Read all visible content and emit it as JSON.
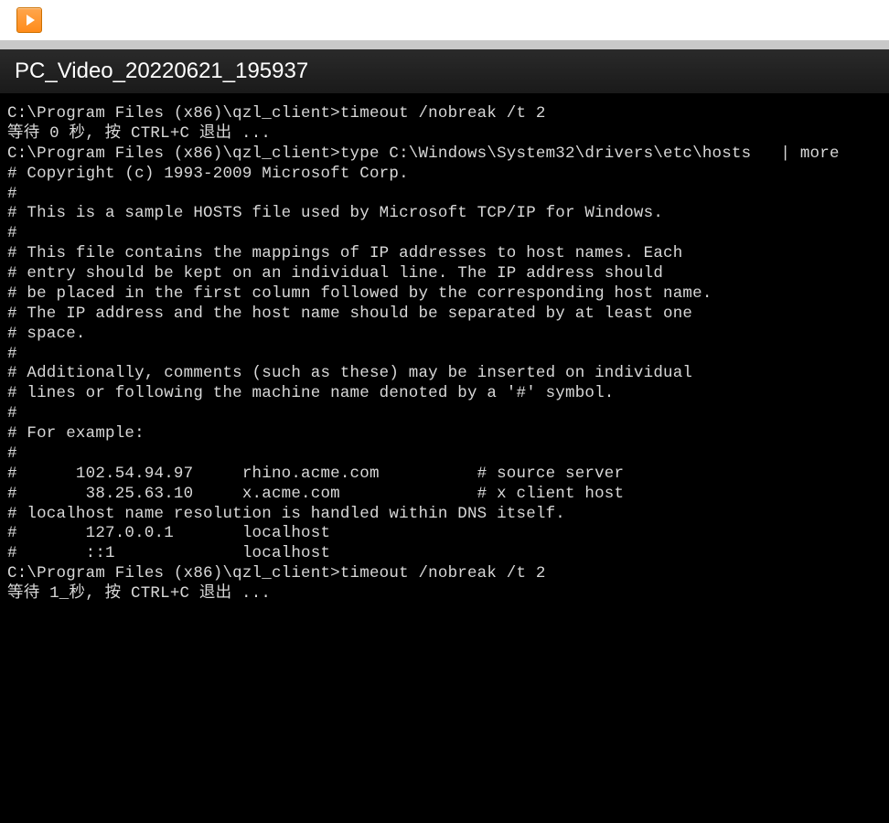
{
  "toolbar": {
    "play_icon_name": "play-icon"
  },
  "title": "PC_Video_20220621_195937",
  "terminal": {
    "lines": [
      "C:\\Program Files (x86)\\qzl_client>timeout /nobreak /t 2",
      "",
      "等待 0 秒, 按 CTRL+C 退出 ...",
      "",
      "C:\\Program Files (x86)\\qzl_client>type C:\\Windows\\System32\\drivers\\etc\\hosts   | more",
      "# Copyright (c) 1993-2009 Microsoft Corp.",
      "#",
      "# This is a sample HOSTS file used by Microsoft TCP/IP for Windows.",
      "#",
      "# This file contains the mappings of IP addresses to host names. Each",
      "# entry should be kept on an individual line. The IP address should",
      "# be placed in the first column followed by the corresponding host name.",
      "# The IP address and the host name should be separated by at least one",
      "# space.",
      "#",
      "# Additionally, comments (such as these) may be inserted on individual",
      "# lines or following the machine name denoted by a '#' symbol.",
      "#",
      "# For example:",
      "#",
      "#      102.54.94.97     rhino.acme.com          # source server",
      "#       38.25.63.10     x.acme.com              # x client host",
      "",
      "# localhost name resolution is handled within DNS itself.",
      "#       127.0.0.1       localhost",
      "#       ::1             localhost",
      "",
      "",
      "C:\\Program Files (x86)\\qzl_client>timeout /nobreak /t 2",
      "",
      "等待 1_秒, 按 CTRL+C 退出 ..."
    ]
  }
}
